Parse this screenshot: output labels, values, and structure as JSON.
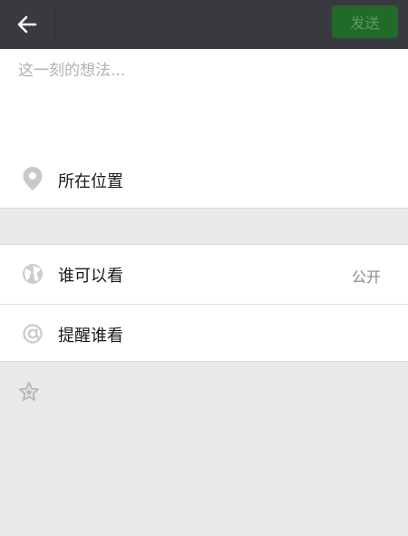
{
  "header": {
    "back_icon": "arrow-left-icon",
    "send_label": "发送"
  },
  "compose": {
    "placeholder": "这一刻的想法...",
    "location_label": "所在位置",
    "location_icon": "map-pin-icon"
  },
  "options": [
    {
      "label": "谁可以看",
      "value": "公开",
      "icon": "globe-icon"
    },
    {
      "label": "提醒谁看",
      "icon": "at-sign-icon"
    }
  ],
  "footer": {
    "star_icon": "star-icon"
  },
  "colors": {
    "header_bg": "#393a3f",
    "send_bg": "#206b27",
    "send_text": "#5c9a63",
    "page_bg": "#e9e9e9"
  }
}
